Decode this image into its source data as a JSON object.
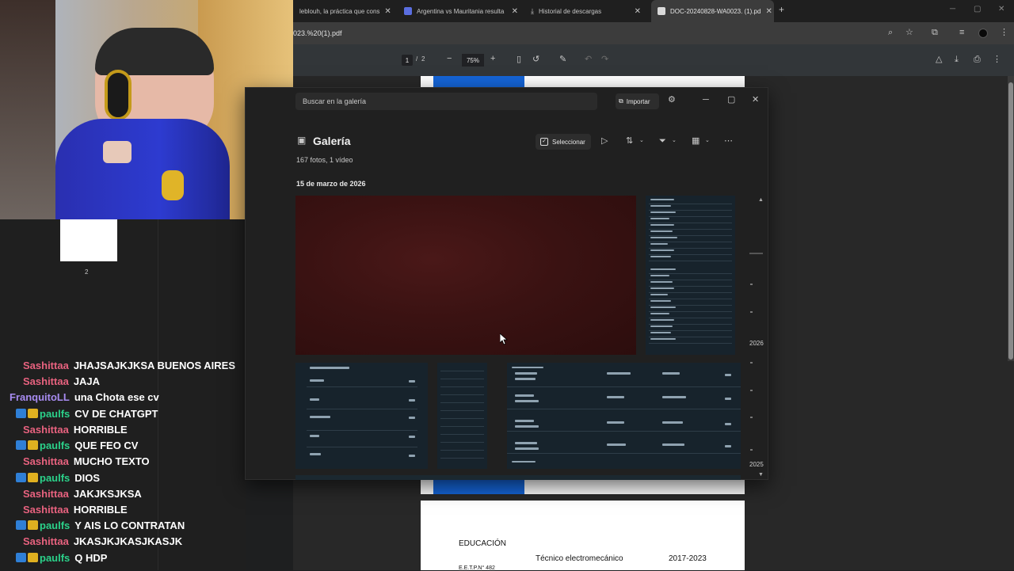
{
  "browser": {
    "tabs": [
      {
        "label": "leblouh, la práctica que cons"
      },
      {
        "label": "Argentina vs Mauritania resulta"
      },
      {
        "label": "Historial de descargas"
      },
      {
        "label": "DOC-20240828-WA0023. (1).pd"
      }
    ],
    "new_tab": "+",
    "url": "023.%20(1).pdf",
    "pdf_toolbar": {
      "current_page": "1",
      "separator": "/",
      "total_pages": "2",
      "zoom": "75%",
      "minus": "−",
      "plus": "+"
    }
  },
  "pdf_sidebar": {
    "thumb_page_label": "2"
  },
  "gallery": {
    "search_placeholder": "Buscar en la galería",
    "import_label": "Importar",
    "title": "Galería",
    "subtitle": "167 fotos, 1 vídeo",
    "select_label": "Seleccionar",
    "date_header": "15 de marzo de 2026",
    "timeline": [
      {
        "label": "2026"
      },
      {
        "label": "2025"
      }
    ]
  },
  "chat": [
    {
      "user": "Sashittaa",
      "color": "#e8627f",
      "badges": false,
      "text": "JHAJSAJKJKSA BUENOS AIRES"
    },
    {
      "user": "Sashittaa",
      "color": "#e8627f",
      "badges": false,
      "text": "JAJA"
    },
    {
      "user": "FranquitoLL",
      "color": "#a78bf0",
      "badges": false,
      "text": "una Chota ese cv"
    },
    {
      "user": "paulfs",
      "color": "#2bd18a",
      "badges": true,
      "text": "CV DE CHATGPT"
    },
    {
      "user": "Sashittaa",
      "color": "#e8627f",
      "badges": false,
      "text": "HORRIBLE"
    },
    {
      "user": "paulfs",
      "color": "#2bd18a",
      "badges": true,
      "text": "QUE FEO CV"
    },
    {
      "user": "Sashittaa",
      "color": "#e8627f",
      "badges": false,
      "text": "MUCHO TEXTO"
    },
    {
      "user": "paulfs",
      "color": "#2bd18a",
      "badges": true,
      "text": "DIOS"
    },
    {
      "user": "Sashittaa",
      "color": "#e8627f",
      "badges": false,
      "text": "JAKJKSJKSA"
    },
    {
      "user": "Sashittaa",
      "color": "#e8627f",
      "badges": false,
      "text": "HORRIBLE"
    },
    {
      "user": "paulfs",
      "color": "#2bd18a",
      "badges": true,
      "text": "Y AIS LO CONTRATAN"
    },
    {
      "user": "Sashittaa",
      "color": "#e8627f",
      "badges": false,
      "text": "JKASJKJKASJKASJK"
    },
    {
      "user": "paulfs",
      "color": "#2bd18a",
      "badges": true,
      "text": "Q HDP"
    }
  ],
  "pdf_page": {
    "section": "EDUCACIÓN",
    "degree": "Técnico electromecánico",
    "years": "2017-2023",
    "school": "E.E.T.P.N° 482"
  },
  "colors": {
    "pdf_blue": "#1565d8",
    "gallery_bg": "#202020",
    "chat_bg": "#1f1f1f"
  }
}
